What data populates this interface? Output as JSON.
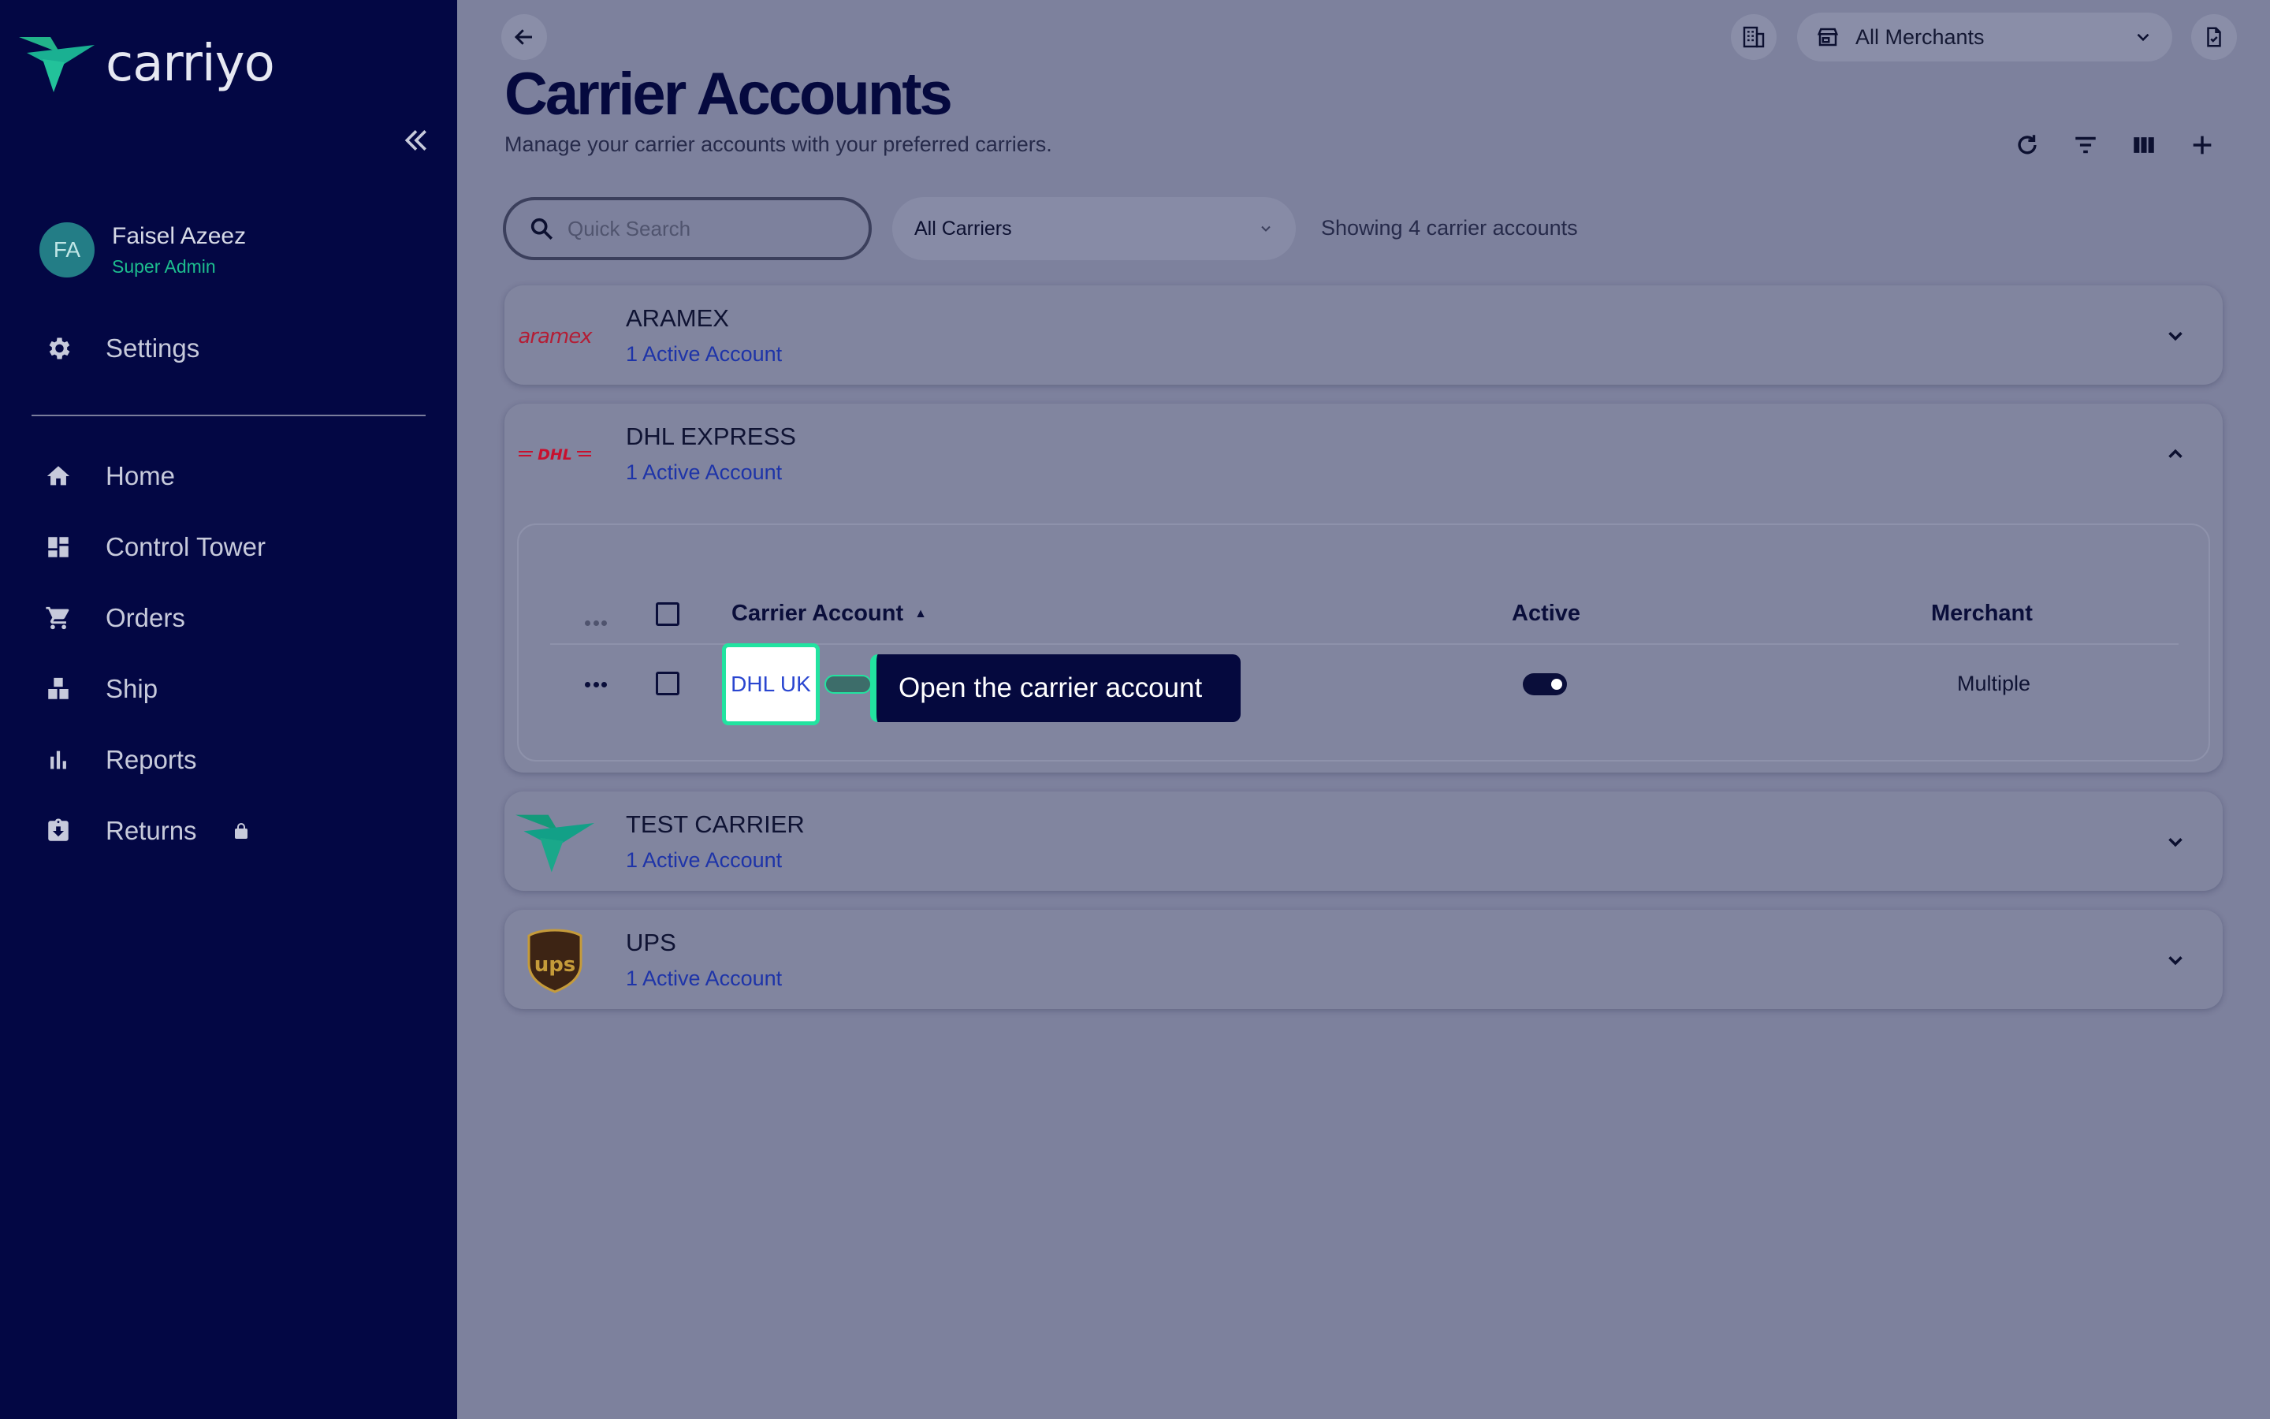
{
  "app": {
    "brand": "carriyo"
  },
  "user": {
    "initials": "FA",
    "name": "Faisel Azeez",
    "role": "Super Admin"
  },
  "sidebar": {
    "settings_label": "Settings",
    "items": [
      {
        "label": "Home",
        "icon": "home-icon"
      },
      {
        "label": "Control Tower",
        "icon": "dashboard-icon"
      },
      {
        "label": "Orders",
        "icon": "cart-icon"
      },
      {
        "label": "Ship",
        "icon": "ship-icon"
      },
      {
        "label": "Reports",
        "icon": "bar-chart-icon"
      },
      {
        "label": "Returns",
        "icon": "returns-icon"
      }
    ]
  },
  "header": {
    "merchant_select": "All Merchants",
    "title": "Carrier Accounts",
    "subtitle": "Manage your carrier accounts with your preferred carriers."
  },
  "filters": {
    "search_placeholder": "Quick Search",
    "carrier_select": "All Carriers",
    "count_text": "Showing 4 carrier accounts"
  },
  "carriers": [
    {
      "name": "ARAMEX",
      "active": "1 Active Account",
      "logo_text": "aramex"
    },
    {
      "name": "DHL EXPRESS",
      "active": "1 Active Account",
      "logo_text": "DHL"
    },
    {
      "name": "TEST CARRIER",
      "active": "1 Active Account"
    },
    {
      "name": "UPS",
      "active": "1 Active Account",
      "logo_text": "ups"
    }
  ],
  "table": {
    "headers": {
      "account": "Carrier Account",
      "active": "Active",
      "merchant": "Merchant"
    },
    "rows": [
      {
        "account": "DHL UK",
        "active": true,
        "merchant": "Multiple"
      }
    ]
  },
  "tooltip": "Open the carrier account",
  "colors": {
    "sidebar": "#030744",
    "accent_green": "#22e3a0",
    "link_blue": "#1e34a8"
  }
}
